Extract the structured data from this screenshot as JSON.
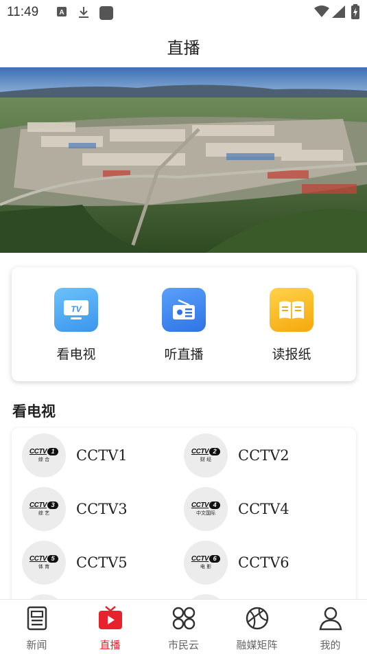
{
  "status_bar": {
    "time": "11:49",
    "left_icons": [
      "a-badge-icon",
      "download-icon",
      "square-app-icon"
    ],
    "right_icons": [
      "wifi-icon",
      "signal-icon",
      "battery-charging-icon"
    ]
  },
  "header": {
    "title": "直播"
  },
  "banner": {
    "image": "aerial-town-landscape",
    "slide_count": 4,
    "active_slide": 1,
    "indicator_color": "#2f8cff"
  },
  "quick_links": [
    {
      "label": "看电视",
      "icon": "tv-icon",
      "color": "#4aa6f5"
    },
    {
      "label": "听直播",
      "icon": "radio-icon",
      "color": "#3f86f0"
    },
    {
      "label": "读报纸",
      "icon": "newspaper-icon",
      "color": "#f7b414"
    }
  ],
  "section": {
    "title": "看电视"
  },
  "channels": [
    {
      "name": "CCTV1",
      "num": "1",
      "sub": "综 合"
    },
    {
      "name": "CCTV2",
      "num": "2",
      "sub": "财 经"
    },
    {
      "name": "CCTV3",
      "num": "3",
      "sub": "综 艺"
    },
    {
      "name": "CCTV4",
      "num": "4",
      "sub": "中文国际"
    },
    {
      "name": "CCTV5",
      "num": "5",
      "sub": "体 育"
    },
    {
      "name": "CCTV6",
      "num": "6",
      "sub": "电 影"
    }
  ],
  "logo_text": "CCTV",
  "tabs": [
    {
      "label": "新闻",
      "icon": "news-icon",
      "active": false
    },
    {
      "label": "直播",
      "icon": "live-play-icon",
      "active": true
    },
    {
      "label": "市民云",
      "icon": "cloud-grid-icon",
      "active": false
    },
    {
      "label": "融媒矩阵",
      "icon": "media-matrix-icon",
      "active": false
    },
    {
      "label": "我的",
      "icon": "profile-icon",
      "active": false
    }
  ],
  "colors": {
    "accent": "#e8222c",
    "inactive": "#666666"
  }
}
